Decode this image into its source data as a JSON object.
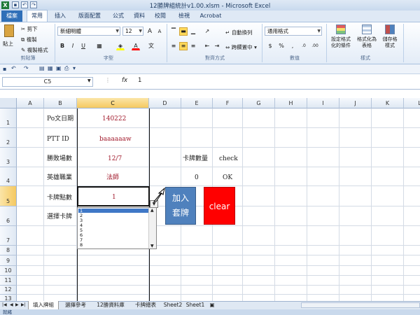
{
  "window": {
    "title": "12勝牌組統計v1.00.xlsm  -  Microsoft Excel"
  },
  "tabs": [
    "檔案",
    "常用",
    "插入",
    "版面配置",
    "公式",
    "資料",
    "校閱",
    "檢視",
    "Acrobat"
  ],
  "ribbon": {
    "clipboard": {
      "paste": "貼上",
      "cut": "剪下",
      "copy": "複製",
      "format_painter": "複製格式",
      "label": "剪貼簿"
    },
    "font": {
      "name": "新細明體",
      "size": "12",
      "label": "字型",
      "bold": "B",
      "italic": "I",
      "underline": "U",
      "grow": "A",
      "shrink": "A"
    },
    "alignment": {
      "wrap": "自動換列",
      "merge": "跨欄置中",
      "label": "對齊方式"
    },
    "number": {
      "format": "通用格式",
      "label": "數值",
      "currency": "$",
      "percent": "%",
      "comma": ",",
      "inc": ".0",
      "dec": ".00"
    },
    "styles": {
      "conditional": "設定格式化的條件",
      "table": "格式化為表格",
      "cell_styles": "儲存格樣式",
      "label": "樣式"
    }
  },
  "formula_bar": {
    "name_box": "C5",
    "fx": "fx",
    "value": "1"
  },
  "columns": [
    "A",
    "B",
    "C",
    "D",
    "E",
    "F",
    "G",
    "H",
    "I",
    "J",
    "K",
    "L"
  ],
  "rows": [
    "1",
    "2",
    "3",
    "4",
    "5",
    "6",
    "7",
    "8",
    "9",
    "10",
    "11",
    "12",
    "13",
    "14"
  ],
  "cells": {
    "B1": "Po文日期",
    "C1": "140222",
    "B2": "PTT ID",
    "C2": "baaaaaaw",
    "B3": "勝敗場數",
    "C3": "12/7",
    "E3": "卡牌數量",
    "F3": "check",
    "B4": "英雄職業",
    "C4": "法師",
    "E4": "0",
    "F4": "OK",
    "B5": "卡牌點數",
    "C5": "1",
    "B6": "選擇卡牌"
  },
  "dropdown": {
    "options": [
      "1",
      "2",
      "3",
      "4",
      "5",
      "6",
      "7",
      "8"
    ],
    "selected": "1"
  },
  "buttons": {
    "add": "加入套牌",
    "add_line1": "加入",
    "add_line2": "套牌",
    "clear": "clear"
  },
  "sheet_tabs": [
    "填入牌組",
    "選擇參考",
    "12勝資料庫",
    "卡牌總表",
    "Sheet2",
    "Sheet1"
  ],
  "active_sheet": "填入牌組",
  "status": {
    "text": "就緒"
  },
  "colors": {
    "accent": "#4f81bd",
    "clear": "#ff0000",
    "selection": "#f5c960",
    "value_text": "#a1192b"
  }
}
